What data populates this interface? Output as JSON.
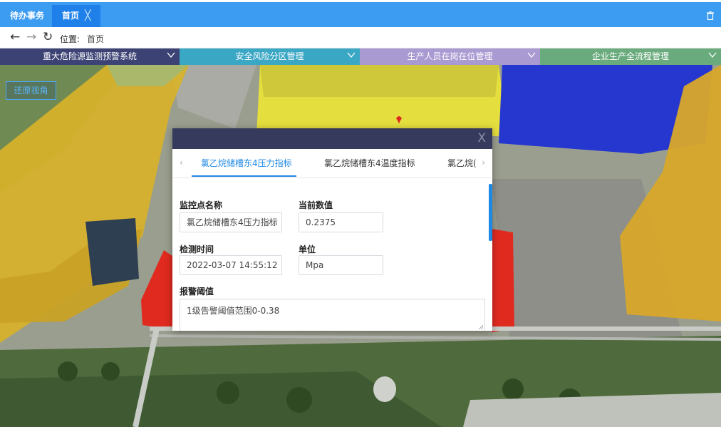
{
  "tabs": [
    {
      "label": "待办事务"
    },
    {
      "label": "首页",
      "close": "╳"
    }
  ],
  "nav": {
    "location_label": "位置:",
    "location_value": "首页"
  },
  "menus": [
    {
      "label": "重大危险源监测预警系统",
      "color": "#3c4274"
    },
    {
      "label": "安全风险分区管理",
      "color": "#3aa7c4"
    },
    {
      "label": "生产人员在岗在位管理",
      "color": "#a99ad2"
    },
    {
      "label": "企业生产全流程管理",
      "color": "#6aab7d"
    }
  ],
  "scene": {
    "restore_view_label": "还原视角",
    "zone_colors": [
      "#d8b22a",
      "#e8e23a",
      "#1b2fd4",
      "#e02a20"
    ]
  },
  "popup": {
    "close": "X",
    "tabs": [
      {
        "label": "氯乙烷储槽东4压力指标",
        "active": true
      },
      {
        "label": "氯乙烷储槽东4温度指标",
        "active": false
      },
      {
        "label": "氯乙烷(",
        "active": false
      }
    ],
    "fields": {
      "name_label": "监控点名称",
      "name_value": "氯乙烷储槽东4压力指标",
      "current_label": "当前数值",
      "current_value": "0.2375",
      "time_label": "检测时间",
      "time_value": "2022-03-07 14:55:12",
      "unit_label": "单位",
      "unit_value": "Mpa",
      "threshold_label": "报警阈值",
      "threshold_value": "1级告警阈值范围0-0.38"
    },
    "accent_color": "#1e88e5"
  }
}
